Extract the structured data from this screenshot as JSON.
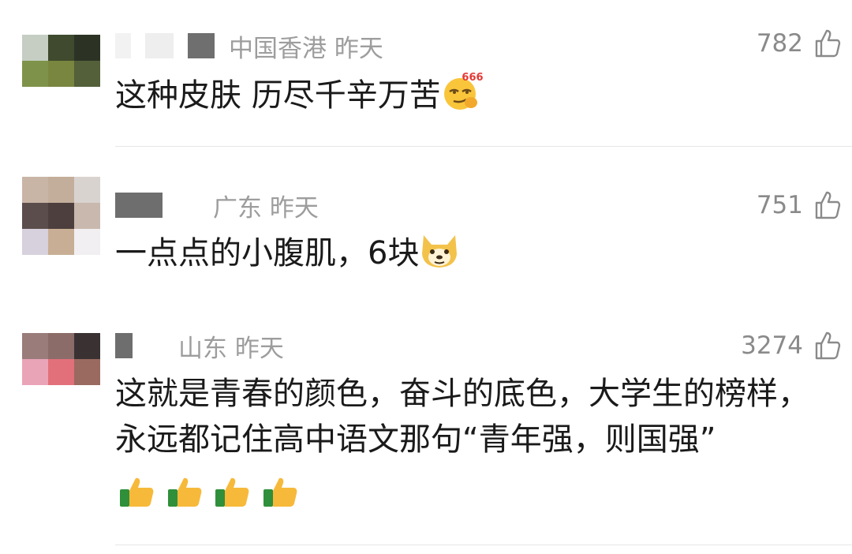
{
  "comments": [
    {
      "location": "中国香港",
      "time": "昨天",
      "likes": "782",
      "text": "这种皮肤 历尽千辛万苦",
      "emoji_badge": "666",
      "emojis": [
        "smirk-666-emoji"
      ],
      "avatar_colors": [
        "#c6cec4",
        "#3f4a2e",
        "#2d3324",
        "#7e9349",
        "#79863f",
        "#53603a"
      ]
    },
    {
      "location": "广东",
      "time": "昨天",
      "likes": "751",
      "text": "一点点的小腹肌，6块",
      "emojis": [
        "doge-emoji"
      ],
      "avatar_colors": [
        "#c9b5a6",
        "#c3ae9b",
        "#d9d3cf",
        "#5b4d4b",
        "#4d3f3e",
        "#c9b8ad",
        "#d6d1dc",
        "#c8ae94",
        "#f1eff1"
      ]
    },
    {
      "location": "山东",
      "time": "昨天",
      "likes": "3274",
      "text": "这就是青春的颜色，奋斗的底色，大学生的榜样，永远都记住高中语文那句“青年强，则国强”",
      "emojis": [
        "thumbs-up-emoji",
        "thumbs-up-emoji",
        "thumbs-up-emoji",
        "thumbs-up-emoji"
      ],
      "avatar_colors": [
        "#9a7c7a",
        "#8c6c69",
        "#3a3232",
        "#e9a4b8",
        "#e2707b",
        "#9a6a61"
      ]
    }
  ],
  "icons": {
    "like": "thumbs-up-outline-icon"
  },
  "colors": {
    "meta_text": "#9d9d9d",
    "body_text": "#1a1a1a",
    "divider": "#e6e6e6"
  }
}
